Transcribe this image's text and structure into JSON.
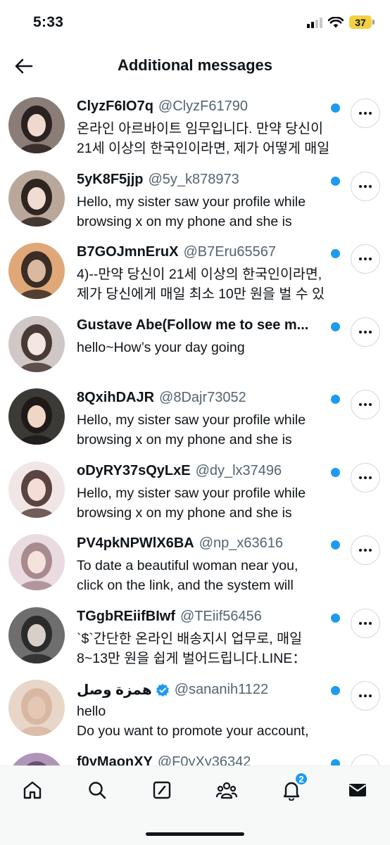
{
  "status_bar": {
    "time": "5:33",
    "battery": "37"
  },
  "header": {
    "title": "Additional messages"
  },
  "messages": [
    {
      "name": "ClyzF6IO7q",
      "handle": "@ClyzF61790",
      "preview": "온라인 아르바이트 임무입니다. 만약 당신이\n21세 이상의 한국인이라면, 제가 어떻게 매일",
      "bg": "#8a7d78",
      "hair": "#2a2220",
      "skin": "#efd9cf"
    },
    {
      "name": "5yK8F5jjp",
      "handle": "@5y_k878973",
      "preview": "Hello, my sister saw your profile while\nbrowsing x on my phone and she is",
      "bg": "#b9a89a",
      "hair": "#2e2520",
      "skin": "#f0dcd0"
    },
    {
      "name": "B7GOJmnEruX",
      "handle": "@B7Eru65567",
      "preview": "4)--만약 당신이 21세 이상의 한국인이라면,\n제가 당신에게 매일 최소 10만 원을 벌 수 있",
      "bg": "#e0a878",
      "hair": "#3a2d25",
      "skin": "#d9b9a0"
    },
    {
      "name": "Gustave Abe(Follow me to see m...",
      "handle": "",
      "preview": "hello~How’s your day going",
      "bg": "#cfc8c6",
      "hair": "#4a3a36",
      "skin": "#f4e6e0"
    },
    {
      "name": "8QxihDAJR",
      "handle": "@8Dajr73052",
      "preview": "Hello, my sister saw your profile while\nbrowsing x on my phone and she is",
      "bg": "#3b3a36",
      "hair": "#1f1a18",
      "skin": "#efd6c8"
    },
    {
      "name": "oDyRY37sQyLxE",
      "handle": "@dy_lx37496",
      "preview": "Hello, my sister saw your profile while\nbrowsing x on my phone and she is",
      "bg": "#f0e6e6",
      "hair": "#5a4340",
      "skin": "#f3ddd6"
    },
    {
      "name": "PV4pkNPWlX6BA",
      "handle": "@np_x63616",
      "preview": "To date a beautiful woman near you,\nclick on the link, and the system will",
      "bg": "#e9dbe0",
      "hair": "#a98a8e",
      "skin": "#f5e2dc"
    },
    {
      "name": "TGgbREiifBIwf",
      "handle": "@TEiif56456",
      "preview": "`$`간단한 온라인 배송지시 업무로, 매일\n8~13만 원을 쉽게 벌어드립니다.LINE：",
      "bg": "#6e6e6e",
      "hair": "#2b2b2b",
      "skin": "#d8cfc8"
    },
    {
      "name": "همزة وصل",
      "handle": "@sananih1122",
      "preview": "hello\nDo you want to promote your account,",
      "bg": "#e8d6c8",
      "hair": "#d9b8a3",
      "skin": "#e4c7b4",
      "verified": true
    },
    {
      "name": "f0yMaonXY",
      "handle": "@F0yXy36342",
      "preview": "",
      "bg": "#b095b8",
      "hair": "#6e5075",
      "skin": "#e5d2dc"
    }
  ],
  "nav": {
    "notifications_badge": "2"
  },
  "colors": {
    "accent": "#1d9bf0",
    "text": "#0f1419",
    "secondary": "#536471"
  }
}
